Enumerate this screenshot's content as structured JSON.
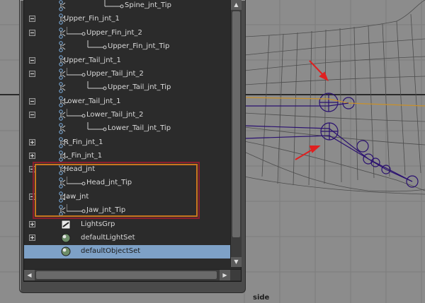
{
  "viewport": {
    "label": "side",
    "background": "#8c8c8c",
    "wire_color": "#4d4d4d",
    "joint_color": "#2a1070",
    "bone_fill": "#b8862c"
  },
  "annotations": {
    "arrow_color": "#e02020",
    "box_outer_color": "#8a1e2e",
    "box_inner_color": "#c8761e"
  },
  "outliner": {
    "items": [
      {
        "label": "Spine_jnt_Tip",
        "icon": "joint-icon",
        "expander": "none"
      },
      {
        "label": "Upper_Fin_jnt_1",
        "icon": "joint-icon",
        "expander": "minus"
      },
      {
        "label": "Upper_Fin_jnt_2",
        "icon": "joint-icon",
        "expander": "minus"
      },
      {
        "label": "Upper_Fin_jnt_Tip",
        "icon": "joint-icon",
        "expander": "none"
      },
      {
        "label": "Upper_Tail_jnt_1",
        "icon": "joint-icon",
        "expander": "minus"
      },
      {
        "label": "Upper_Tail_jnt_2",
        "icon": "joint-icon",
        "expander": "minus"
      },
      {
        "label": "Upper_Tail_jnt_Tip",
        "icon": "joint-icon",
        "expander": "none"
      },
      {
        "label": "Lower_Tail_jnt_1",
        "icon": "joint-icon",
        "expander": "minus"
      },
      {
        "label": "Lower_Tail_jnt_2",
        "icon": "joint-icon",
        "expander": "minus"
      },
      {
        "label": "Lower_Tail_jnt_Tip",
        "icon": "joint-icon",
        "expander": "none"
      },
      {
        "label": "R_Fin_jnt_1",
        "icon": "joint-icon",
        "expander": "plus"
      },
      {
        "label": "L_Fin_jnt_1",
        "icon": "joint-icon",
        "expander": "plus"
      },
      {
        "label": "Head_jnt",
        "icon": "joint-icon",
        "expander": "minus"
      },
      {
        "label": "Head_jnt_Tip",
        "icon": "joint-icon",
        "expander": "none"
      },
      {
        "label": "Jaw_jnt",
        "icon": "joint-icon",
        "expander": "minus"
      },
      {
        "label": "Jaw_jnt_Tip",
        "icon": "joint-icon",
        "expander": "none"
      },
      {
        "label": "LightsGrp",
        "icon": "group-icon",
        "expander": "plus"
      },
      {
        "label": "defaultLightSet",
        "icon": "set-icon",
        "expander": "plus"
      },
      {
        "label": "defaultObjectSet",
        "icon": "set-icon",
        "expander": "none",
        "selected": true
      }
    ],
    "selection_color": "#7ea1c7"
  }
}
